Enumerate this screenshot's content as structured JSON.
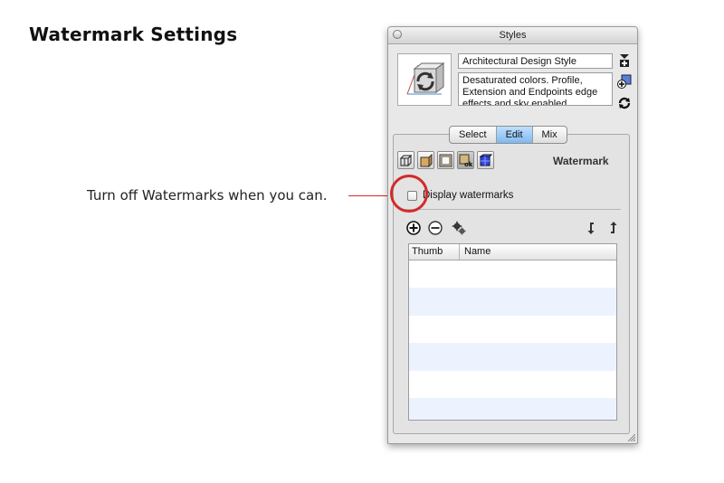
{
  "slide": {
    "title": "Watermark Settings",
    "callout": "Turn off Watermarks when you can."
  },
  "window": {
    "title": "Styles"
  },
  "style": {
    "name": "Architectural Design Style",
    "description": "Desaturated colors. Profile, Extension and Endpoints edge effects and sky enabled"
  },
  "tabs": [
    {
      "label": "Select",
      "active": false
    },
    {
      "label": "Edit",
      "active": true
    },
    {
      "label": "Mix",
      "active": false
    }
  ],
  "edit_section": {
    "icons": [
      "edge-settings-icon",
      "face-settings-icon",
      "background-settings-icon",
      "watermark-settings-icon",
      "modeling-settings-icon"
    ],
    "active_icon": "watermark-settings-icon",
    "label": "Watermark"
  },
  "watermarks": {
    "checkbox_label": "Display watermarks",
    "checked": false,
    "table_headers": {
      "thumb": "Thumb",
      "name": "Name"
    },
    "rows": []
  },
  "colors": {
    "callout": "#d42a2a",
    "active_tab": "#8fc2f3",
    "row_stripe": "#edf3fe"
  }
}
